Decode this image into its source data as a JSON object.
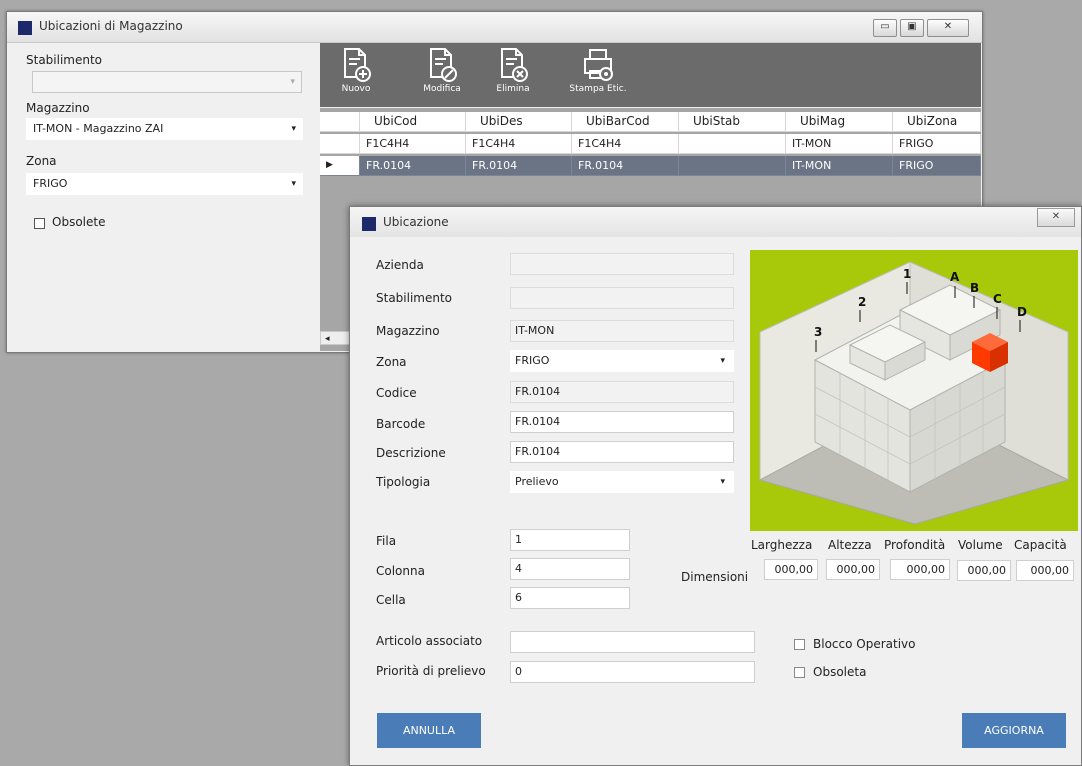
{
  "main_window": {
    "title": "Ubicazioni di Magazzino",
    "left_panel": {
      "stabilimento_label": "Stabilimento",
      "stabilimento_value": "",
      "magazzino_label": "Magazzino",
      "magazzino_value": "IT-MON - Magazzino ZAI",
      "zona_label": "Zona",
      "zona_value": "FRIGO",
      "obsolete_label": "Obsolete"
    },
    "toolbar": {
      "nuovo": "Nuovo",
      "modifica": "Modifica",
      "elimina": "Elimina",
      "stampa": "Stampa Etic."
    },
    "grid": {
      "columns": [
        "UbiCod",
        "UbiDes",
        "UbiBarCod",
        "UbiStab",
        "UbiMag",
        "UbiZona"
      ],
      "rows": [
        [
          "F1C4H4",
          "F1C4H4",
          "F1C4H4",
          "",
          "IT-MON",
          "FRIGO"
        ],
        [
          "FR.0104",
          "FR.0104",
          "FR.0104",
          "",
          "IT-MON",
          "FRIGO"
        ]
      ],
      "selected_row": 1,
      "scroll_left": "◂"
    },
    "caption_buttons": {
      "minimize": "▭",
      "maximize": "▣",
      "close": "✕"
    }
  },
  "dialog": {
    "title": "Ubicazione",
    "close": "✕",
    "fields": {
      "azienda": {
        "label": "Azienda",
        "value": ""
      },
      "stabilimento": {
        "label": "Stabilimento",
        "value": ""
      },
      "magazzino": {
        "label": "Magazzino",
        "value": "IT-MON"
      },
      "zona": {
        "label": "Zona",
        "value": "FRIGO"
      },
      "codice": {
        "label": "Codice",
        "value": "FR.0104"
      },
      "barcode": {
        "label": "Barcode",
        "value": "FR.0104"
      },
      "descrizione": {
        "label": "Descrizione",
        "value": "FR.0104"
      },
      "tipologia": {
        "label": "Tipologia",
        "value": "Prelievo"
      },
      "fila": {
        "label": "Fila",
        "value": "1"
      },
      "colonna": {
        "label": "Colonna",
        "value": "4"
      },
      "cella": {
        "label": "Cella",
        "value": "6"
      },
      "articolo": {
        "label": "Articolo associato",
        "value": ""
      },
      "priorita": {
        "label": "Priorità di prelievo",
        "value": "0"
      }
    },
    "dimensions": {
      "label": "Dimensioni",
      "headers": [
        "Larghezza",
        "Altezza",
        "Profondità",
        "Volume",
        "Capacità"
      ],
      "values": [
        "000,00",
        "000,00",
        "000,00",
        "000,00",
        "000,00"
      ]
    },
    "checkboxes": {
      "blocco": "Blocco Operativo",
      "obsoleta": "Obsoleta"
    },
    "buttons": {
      "annulla": "ANNULLA",
      "aggiorna": "AGGIORNA"
    },
    "rack_image": {
      "markers_rows": [
        "1",
        "2",
        "3"
      ],
      "markers_cols": [
        "A",
        "B",
        "C",
        "D"
      ],
      "background": "#a8c80a",
      "highlight": "#ff3a00"
    }
  }
}
